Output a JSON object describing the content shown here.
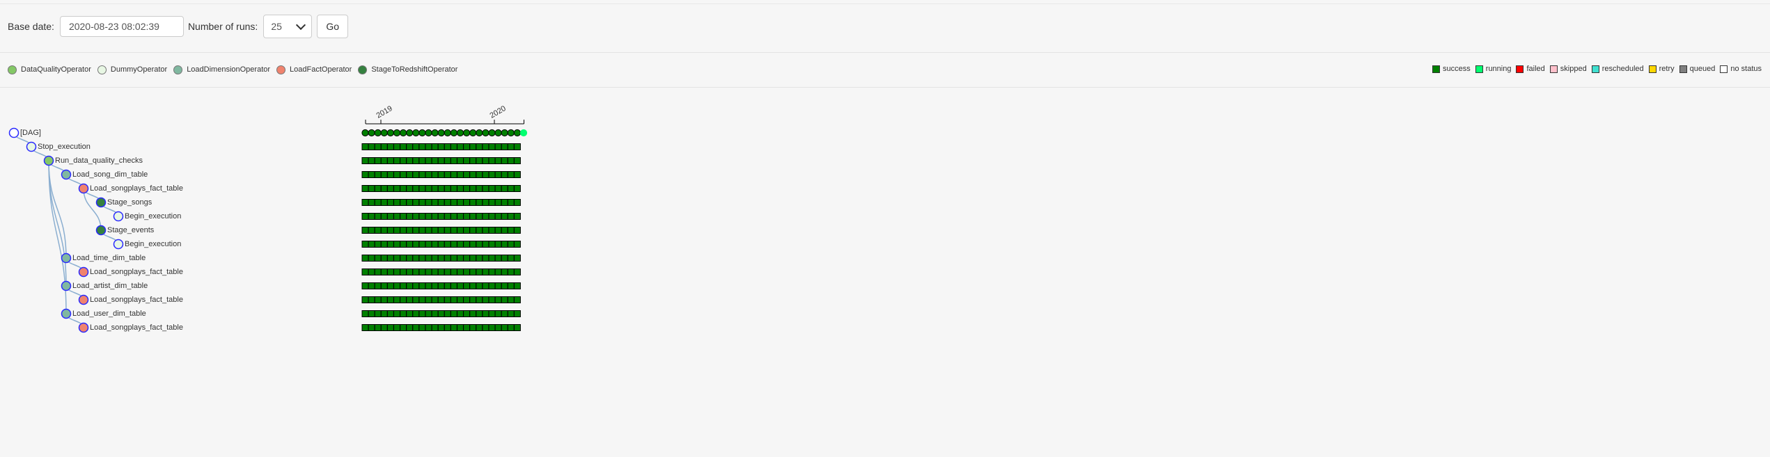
{
  "form": {
    "base_date_label": "Base date:",
    "base_date_value": "2020-08-23 08:02:39",
    "runs_label": "Number of runs:",
    "runs_value": "25",
    "go_label": "Go"
  },
  "operators": [
    {
      "name": "DataQualityOperator",
      "color": "#84c866"
    },
    {
      "name": "DummyOperator",
      "color": "#e8f7e4"
    },
    {
      "name": "LoadDimensionOperator",
      "color": "#80b8a0"
    },
    {
      "name": "LoadFactOperator",
      "color": "#f0836e"
    },
    {
      "name": "StageToRedshiftOperator",
      "color": "#358140"
    }
  ],
  "states": [
    {
      "name": "success",
      "color": "#008000"
    },
    {
      "name": "running",
      "color": "#01ff70"
    },
    {
      "name": "failed",
      "color": "#ff0000"
    },
    {
      "name": "skipped",
      "color": "#ffc0cb"
    },
    {
      "name": "rescheduled",
      "color": "#40e0d0"
    },
    {
      "name": "retry",
      "color": "#ffd700"
    },
    {
      "name": "queued",
      "color": "#808080"
    },
    {
      "name": "no status",
      "color": "#ffffff"
    }
  ],
  "timeline": {
    "year_labels": [
      "2019",
      "2020"
    ],
    "dag_runs_success": 25,
    "dag_run_running": 1,
    "task_squares_per_row": 25
  },
  "tree": [
    {
      "label": "[DAG]",
      "depth": 0,
      "operator": "dag"
    },
    {
      "label": "Stop_execution",
      "depth": 1,
      "operator": "DummyOperator"
    },
    {
      "label": "Run_data_quality_checks",
      "depth": 2,
      "operator": "DataQualityOperator"
    },
    {
      "label": "Load_song_dim_table",
      "depth": 3,
      "operator": "LoadDimensionOperator"
    },
    {
      "label": "Load_songplays_fact_table",
      "depth": 4,
      "operator": "LoadFactOperator"
    },
    {
      "label": "Stage_songs",
      "depth": 5,
      "operator": "StageToRedshiftOperator"
    },
    {
      "label": "Begin_execution",
      "depth": 6,
      "operator": "DummyOperator"
    },
    {
      "label": "Stage_events",
      "depth": 5,
      "operator": "StageToRedshiftOperator"
    },
    {
      "label": "Begin_execution",
      "depth": 6,
      "operator": "DummyOperator"
    },
    {
      "label": "Load_time_dim_table",
      "depth": 3,
      "operator": "LoadDimensionOperator"
    },
    {
      "label": "Load_songplays_fact_table",
      "depth": 4,
      "operator": "LoadFactOperator"
    },
    {
      "label": "Load_artist_dim_table",
      "depth": 3,
      "operator": "LoadDimensionOperator"
    },
    {
      "label": "Load_songplays_fact_table",
      "depth": 4,
      "operator": "LoadFactOperator"
    },
    {
      "label": "Load_user_dim_table",
      "depth": 3,
      "operator": "LoadDimensionOperator"
    },
    {
      "label": "Load_songplays_fact_table",
      "depth": 4,
      "operator": "LoadFactOperator"
    }
  ]
}
